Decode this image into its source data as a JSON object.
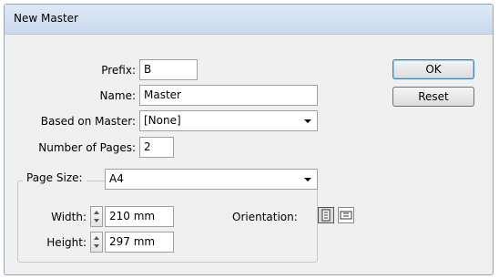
{
  "dialog": {
    "title": "New Master"
  },
  "fields": {
    "prefix": {
      "label": "Prefix:",
      "value": "B"
    },
    "name": {
      "label": "Name:",
      "value": "Master"
    },
    "based_on": {
      "label": "Based on Master:",
      "value": "[None]"
    },
    "num_pages": {
      "label": "Number of Pages:",
      "value": "2"
    }
  },
  "buttons": {
    "ok": "OK",
    "reset": "Reset"
  },
  "page_size": {
    "label": "Page Size:",
    "value": "A4",
    "width": {
      "label": "Width:",
      "value": "210 mm"
    },
    "height": {
      "label": "Height:",
      "value": "297 mm"
    },
    "orientation_label": "Orientation:",
    "orientation_options": [
      "portrait",
      "landscape"
    ],
    "orientation_selected": "portrait"
  }
}
